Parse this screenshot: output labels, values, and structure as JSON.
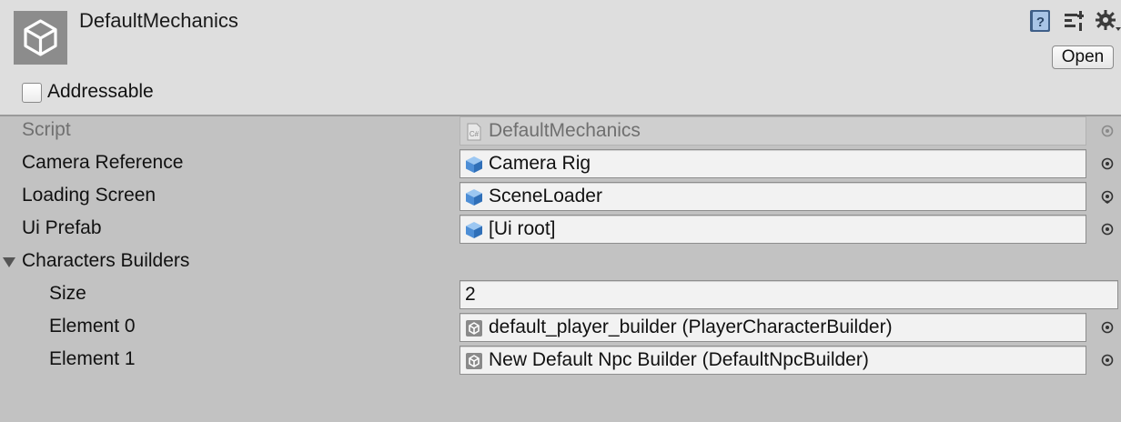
{
  "header": {
    "title": "DefaultMechanics",
    "open_label": "Open",
    "addressable_label": "Addressable",
    "addressable_checked": false,
    "icons": [
      "unity-logo-icon",
      "help-book-icon",
      "preset-icon",
      "gear-menu-icon"
    ]
  },
  "fields": {
    "script": {
      "label": "Script",
      "value": "DefaultMechanics",
      "icon": "csharp-script-icon"
    },
    "camera_reference": {
      "label": "Camera Reference",
      "value": "Camera Rig",
      "icon": "prefab-cube-icon"
    },
    "loading_screen": {
      "label": "Loading Screen",
      "value": "SceneLoader",
      "icon": "prefab-cube-icon"
    },
    "ui_prefab": {
      "label": "Ui Prefab",
      "value": "[Ui root]",
      "icon": "prefab-cube-icon"
    }
  },
  "characters_builders": {
    "label": "Characters Builders",
    "expanded": true,
    "size_label": "Size",
    "size_value": "2",
    "elements": [
      {
        "label": "Element 0",
        "value": "default_player_builder (PlayerCharacterBuilder)",
        "icon": "scriptable-object-icon"
      },
      {
        "label": "Element 1",
        "value": "New Default Npc Builder (DefaultNpcBuilder)",
        "icon": "scriptable-object-icon"
      }
    ]
  },
  "colors": {
    "header_bg": "#dedede",
    "body_bg": "#c2c2c2",
    "field_bg": "#f2f2f2",
    "prefab_blue": "#5a9be0"
  }
}
